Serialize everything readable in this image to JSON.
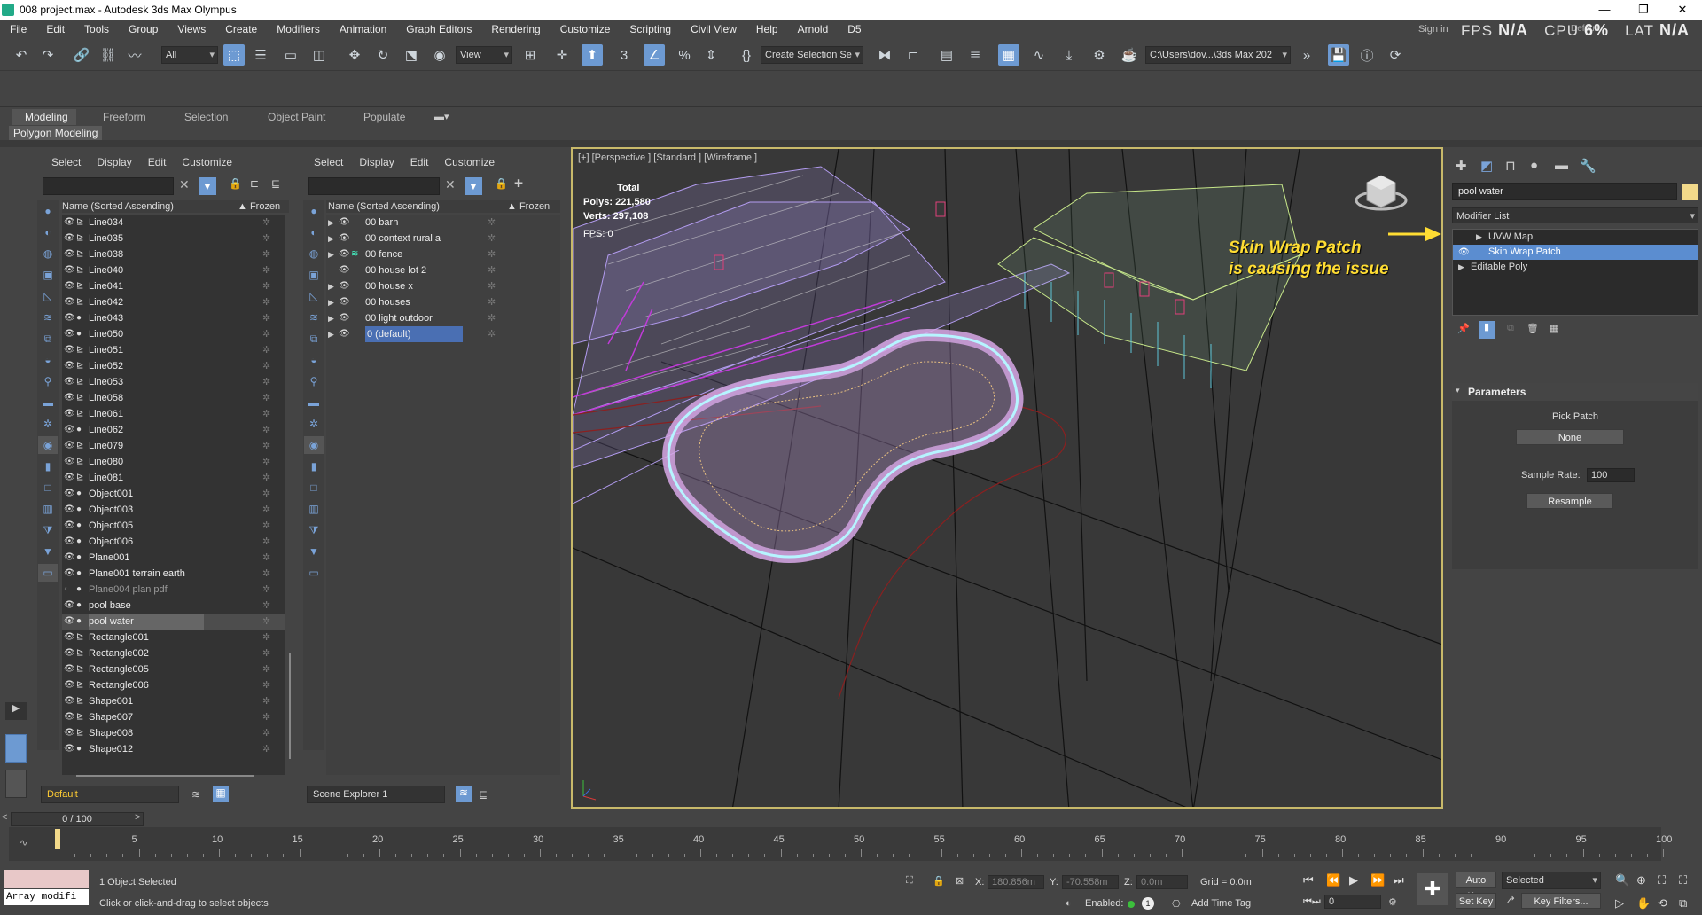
{
  "window": {
    "title": "008 project.max - Autodesk 3ds Max Olympus",
    "min": "—",
    "max": "❐",
    "close": "✕"
  },
  "menu": [
    "File",
    "Edit",
    "Tools",
    "Group",
    "Views",
    "Create",
    "Modifiers",
    "Animation",
    "Graph Editors",
    "Rendering",
    "Customize",
    "Scripting",
    "Civil View",
    "Help",
    "Arnold",
    "D5"
  ],
  "hud": {
    "fps_label": "FPS",
    "fps_value": "N/A",
    "cpu_label": "CPU",
    "cpu_value": "6%",
    "lat_label": "LAT",
    "lat_value": "N/A",
    "signin": "Sign in",
    "workspace": "Default"
  },
  "toolbar": {
    "selection_filter": "All",
    "ref_coord": "View",
    "create_selection_set": "Create Selection Se",
    "path": "C:\\Users\\dov...\\3ds Max 202"
  },
  "shelf_icons": [
    "D",
    "",
    "",
    " ",
    "",
    "",
    "",
    "D5A",
    "SKP",
    ""
  ],
  "ribbon": {
    "tabs": [
      "Modeling",
      "Freeform",
      "Selection",
      "Object Paint",
      "Populate"
    ],
    "active": "Modeling",
    "subtab": "Polygon Modeling"
  },
  "explorer1": {
    "menu": [
      "Select",
      "Display",
      "Edit",
      "Customize"
    ],
    "col_name": "Name (Sorted Ascending)",
    "col_frozen": "▲ Frozen",
    "rows": [
      {
        "name": "Line034",
        "type": "shape"
      },
      {
        "name": "Line035",
        "type": "shape"
      },
      {
        "name": "Line038",
        "type": "shape"
      },
      {
        "name": "Line040",
        "type": "shape"
      },
      {
        "name": "Line041",
        "type": "shape"
      },
      {
        "name": "Line042",
        "type": "shape"
      },
      {
        "name": "Line043",
        "type": "geo"
      },
      {
        "name": "Line050",
        "type": "geo"
      },
      {
        "name": "Line051",
        "type": "shape"
      },
      {
        "name": "Line052",
        "type": "shape"
      },
      {
        "name": "Line053",
        "type": "shape"
      },
      {
        "name": "Line058",
        "type": "shape"
      },
      {
        "name": "Line061",
        "type": "shape"
      },
      {
        "name": "Line062",
        "type": "geo"
      },
      {
        "name": "Line079",
        "type": "shape"
      },
      {
        "name": "Line080",
        "type": "shape"
      },
      {
        "name": "Line081",
        "type": "shape"
      },
      {
        "name": "Object001",
        "type": "geo"
      },
      {
        "name": "Object003",
        "type": "geo"
      },
      {
        "name": "Object005",
        "type": "geo"
      },
      {
        "name": "Object006",
        "type": "geo"
      },
      {
        "name": "Plane001",
        "type": "geo"
      },
      {
        "name": "Plane001 terrain earth",
        "type": "geo"
      },
      {
        "name": "Plane004 plan pdf",
        "type": "geo",
        "hidden": true
      },
      {
        "name": "pool base",
        "type": "geo"
      },
      {
        "name": "pool water",
        "type": "geo",
        "selected": true
      },
      {
        "name": "Rectangle001",
        "type": "shape"
      },
      {
        "name": "Rectangle002",
        "type": "shape"
      },
      {
        "name": "Rectangle005",
        "type": "shape"
      },
      {
        "name": "Rectangle006",
        "type": "shape"
      },
      {
        "name": "Shape001",
        "type": "shape"
      },
      {
        "name": "Shape007",
        "type": "shape"
      },
      {
        "name": "Shape008",
        "type": "shape"
      },
      {
        "name": "Shape012",
        "type": "geo"
      }
    ],
    "footer_dropdown": "Default"
  },
  "explorer2": {
    "menu": [
      "Select",
      "Display",
      "Edit",
      "Customize"
    ],
    "col_name": "Name (Sorted Ascending)",
    "col_frozen": "▲ Frozen",
    "rows": [
      {
        "name": "00 barn",
        "expand": true
      },
      {
        "name": "00 context rural a",
        "expand": true
      },
      {
        "name": "00 fence",
        "expand": true
      },
      {
        "name": "00 house lot 2",
        "expand": false
      },
      {
        "name": "00 house x",
        "expand": true
      },
      {
        "name": "00 houses",
        "expand": true
      },
      {
        "name": "00 light outdoor",
        "expand": true
      },
      {
        "name": "0 (default)",
        "expand": true,
        "selected": true
      }
    ],
    "footer_dropdown": "Scene Explorer 1"
  },
  "viewport": {
    "label": "[+] [Perspective ] [Standard ] [Wireframe ]",
    "stats_total": "Total",
    "polys_label": "Polys:",
    "polys_value": "221,580",
    "verts_label": "Verts:",
    "verts_value": "297,108",
    "fps_label": "FPS:",
    "fps_value": "0",
    "annotation_line1": "Skin Wrap Patch",
    "annotation_line2": "is causing the issue"
  },
  "cmdpanel": {
    "object_name": "pool water",
    "modifier_list": "Modifier List",
    "stack": [
      {
        "name": "UVW Map",
        "expand": true,
        "eye": false
      },
      {
        "name": "Skin Wrap Patch",
        "expand": false,
        "eye": true,
        "selected": true
      },
      {
        "name": "Editable Poly",
        "expand": true,
        "eye": false
      }
    ],
    "params_title": "Parameters",
    "pick_patch_label": "Pick Patch",
    "pick_patch_button": "None",
    "sample_rate_label": "Sample Rate:",
    "sample_rate_value": "100",
    "resample_button": "Resample"
  },
  "timeline": {
    "frame_display": "0 / 100",
    "ticks": [
      "5",
      "10",
      "15",
      "20",
      "25",
      "30",
      "35",
      "40",
      "45",
      "50",
      "55",
      "60",
      "65",
      "70",
      "75",
      "80",
      "85",
      "90",
      "95",
      "100"
    ],
    "start": "0"
  },
  "status": {
    "maxscript": "Array modifi",
    "selected": "1 Object Selected",
    "prompt": "Click or click-and-drag to select objects",
    "x_label": "X:",
    "x_value": "180.856m",
    "y_label": "Y:",
    "y_value": "-70.558m",
    "z_label": "Z:",
    "z_value": "0.0m",
    "grid": "Grid = 0.0m",
    "enabled": "Enabled:",
    "add_time_tag": "Add Time Tag",
    "auto_key": "Auto Key",
    "set_key": "Set Key",
    "selected_dd": "Selected",
    "key_filters": "Key Filters...",
    "frame": "0"
  },
  "colors": {
    "accent": "#6d9ad2",
    "viewport_border": "#c8b96a",
    "annotation": "#ffdd33"
  }
}
